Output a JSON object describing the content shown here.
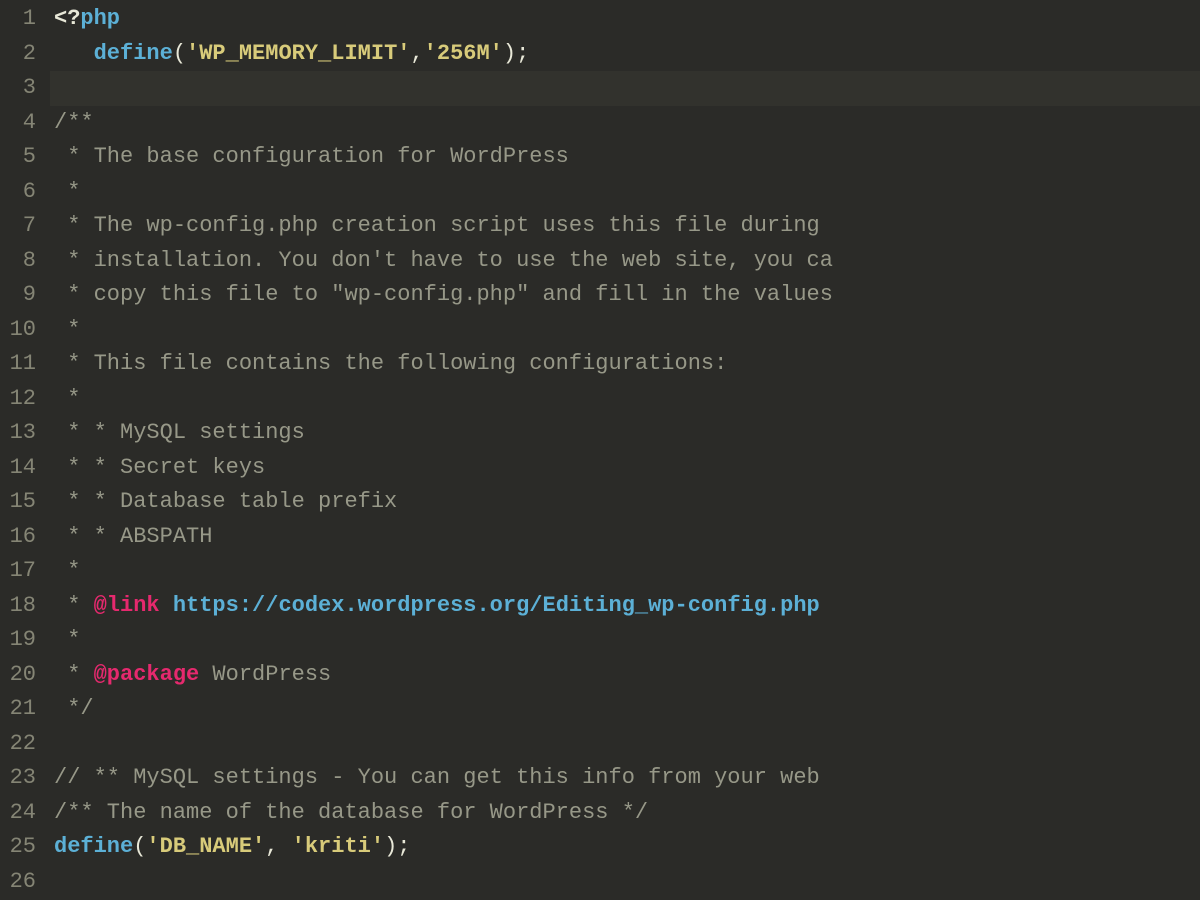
{
  "editor": {
    "language": "php",
    "active_line": 3,
    "lines": [
      {
        "n": 1,
        "tokens": [
          {
            "t": "<?",
            "c": "phpopen"
          },
          {
            "t": "php",
            "c": "keyword"
          }
        ]
      },
      {
        "n": 2,
        "tokens": [
          {
            "t": "   ",
            "c": ""
          },
          {
            "t": "define",
            "c": "func"
          },
          {
            "t": "(",
            "c": "paren"
          },
          {
            "t": "'WP_MEMORY_LIMIT'",
            "c": "string"
          },
          {
            "t": ",",
            "c": "punct"
          },
          {
            "t": "'256M'",
            "c": "string"
          },
          {
            "t": ")",
            "c": "paren"
          },
          {
            "t": ";",
            "c": "punct"
          }
        ]
      },
      {
        "n": 3,
        "tokens": []
      },
      {
        "n": 4,
        "tokens": [
          {
            "t": "/**",
            "c": "comment"
          }
        ]
      },
      {
        "n": 5,
        "tokens": [
          {
            "t": " * The base configuration for WordPress",
            "c": "comment"
          }
        ]
      },
      {
        "n": 6,
        "tokens": [
          {
            "t": " *",
            "c": "comment"
          }
        ]
      },
      {
        "n": 7,
        "tokens": [
          {
            "t": " * The wp-config.php creation script uses this file during",
            "c": "comment"
          }
        ]
      },
      {
        "n": 8,
        "tokens": [
          {
            "t": " * installation. You don't have to use the web site, you ca",
            "c": "comment"
          }
        ]
      },
      {
        "n": 9,
        "tokens": [
          {
            "t": " * copy this file to \"wp-config.php\" and fill in the values",
            "c": "comment"
          }
        ]
      },
      {
        "n": 10,
        "tokens": [
          {
            "t": " *",
            "c": "comment"
          }
        ]
      },
      {
        "n": 11,
        "tokens": [
          {
            "t": " * This file contains the following configurations:",
            "c": "comment"
          }
        ]
      },
      {
        "n": 12,
        "tokens": [
          {
            "t": " *",
            "c": "comment"
          }
        ]
      },
      {
        "n": 13,
        "tokens": [
          {
            "t": " * * MySQL settings",
            "c": "comment"
          }
        ]
      },
      {
        "n": 14,
        "tokens": [
          {
            "t": " * * Secret keys",
            "c": "comment"
          }
        ]
      },
      {
        "n": 15,
        "tokens": [
          {
            "t": " * * Database table prefix",
            "c": "comment"
          }
        ]
      },
      {
        "n": 16,
        "tokens": [
          {
            "t": " * * ABSPATH",
            "c": "comment"
          }
        ]
      },
      {
        "n": 17,
        "tokens": [
          {
            "t": " *",
            "c": "comment"
          }
        ]
      },
      {
        "n": 18,
        "tokens": [
          {
            "t": " * ",
            "c": "comment"
          },
          {
            "t": "@link",
            "c": "doctag"
          },
          {
            "t": " ",
            "c": "comment"
          },
          {
            "t": "https://codex.wordpress.org/Editing_wp-config.php",
            "c": "link"
          }
        ]
      },
      {
        "n": 19,
        "tokens": [
          {
            "t": " *",
            "c": "comment"
          }
        ]
      },
      {
        "n": 20,
        "tokens": [
          {
            "t": " * ",
            "c": "comment"
          },
          {
            "t": "@package",
            "c": "doctag"
          },
          {
            "t": " WordPress",
            "c": "comment"
          }
        ]
      },
      {
        "n": 21,
        "tokens": [
          {
            "t": " */",
            "c": "comment"
          }
        ]
      },
      {
        "n": 22,
        "tokens": []
      },
      {
        "n": 23,
        "tokens": [
          {
            "t": "// ** MySQL settings - You can get this info from your web ",
            "c": "comment"
          }
        ]
      },
      {
        "n": 24,
        "tokens": [
          {
            "t": "/** The name of the database for WordPress */",
            "c": "comment"
          }
        ]
      },
      {
        "n": 25,
        "tokens": [
          {
            "t": "define",
            "c": "func"
          },
          {
            "t": "(",
            "c": "paren"
          },
          {
            "t": "'DB_NAME'",
            "c": "string"
          },
          {
            "t": ", ",
            "c": "punct"
          },
          {
            "t": "'kriti'",
            "c": "string"
          },
          {
            "t": ")",
            "c": "paren"
          },
          {
            "t": ";",
            "c": "punct"
          }
        ]
      },
      {
        "n": 26,
        "tokens": []
      }
    ]
  }
}
